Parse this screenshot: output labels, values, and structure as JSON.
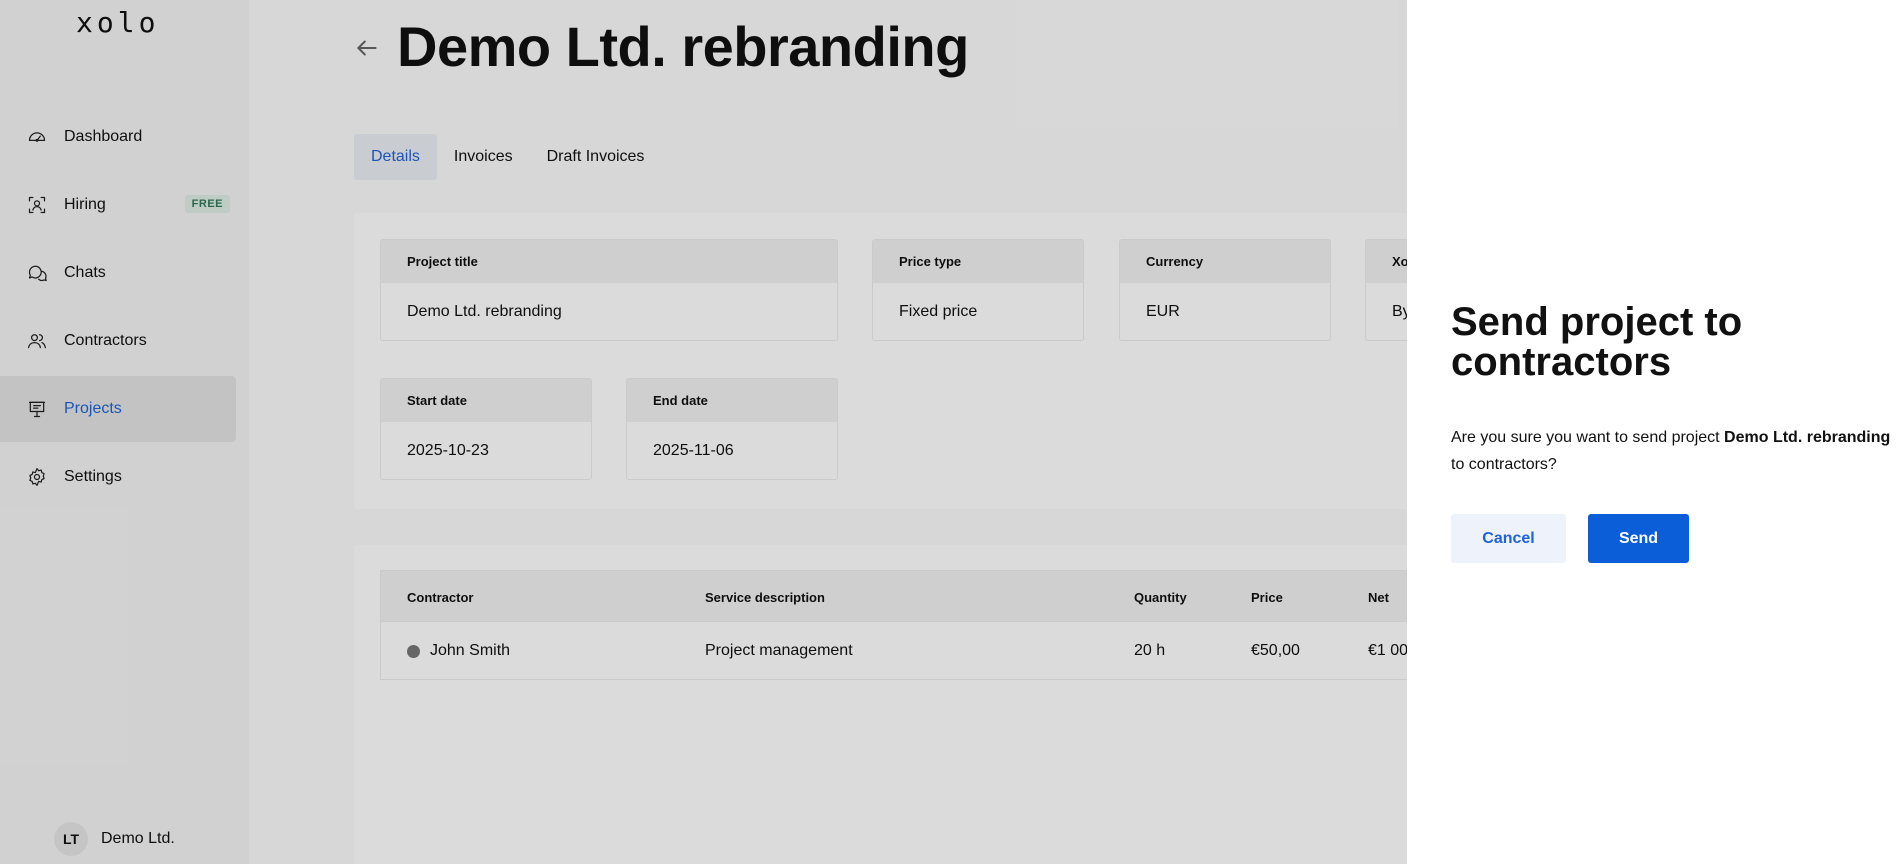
{
  "app": {
    "logo": "xolo"
  },
  "sidebar": {
    "items": [
      {
        "label": "Dashboard",
        "icon": "dashboard-icon"
      },
      {
        "label": "Hiring",
        "icon": "hiring-icon",
        "badge": "FREE"
      },
      {
        "label": "Chats",
        "icon": "chats-icon"
      },
      {
        "label": "Contractors",
        "icon": "contractors-icon"
      },
      {
        "label": "Projects",
        "icon": "projects-icon",
        "active": true
      },
      {
        "label": "Settings",
        "icon": "gear-icon"
      }
    ],
    "account": {
      "initials": "LT",
      "name": "Demo Ltd."
    }
  },
  "page": {
    "title": "Demo Ltd. rebranding",
    "tabs": [
      {
        "label": "Details",
        "active": true
      },
      {
        "label": "Invoices"
      },
      {
        "label": "Draft Invoices"
      }
    ]
  },
  "details": {
    "project_title": {
      "label": "Project title",
      "value": "Demo Ltd. rebranding"
    },
    "price_type": {
      "label": "Price type",
      "value": "Fixed price"
    },
    "currency": {
      "label": "Currency",
      "value": "EUR"
    },
    "xolo_field": {
      "label": "Xo",
      "value": "By"
    },
    "start_date": {
      "label": "Start date",
      "value": "2025-10-23"
    },
    "end_date": {
      "label": "End date",
      "value": "2025-11-06"
    }
  },
  "table": {
    "columns": [
      "Contractor",
      "Service description",
      "Quantity",
      "Price",
      "Net"
    ],
    "rows": [
      {
        "contractor": "John Smith",
        "service": "Project management",
        "quantity": "20 h",
        "price": "€50,00",
        "net": "€1 00"
      }
    ]
  },
  "dialog": {
    "title": "Send project to contractors",
    "text_before": "Are you sure you want to send project ",
    "project_name": "Demo Ltd. rebranding",
    "text_after": " to contractors?",
    "cancel_label": "Cancel",
    "send_label": "Send"
  },
  "colors": {
    "accent": "#1f63d6",
    "primary_button": "#0b5ed7",
    "badge_bg": "#dfeee6",
    "badge_text": "#2f7a55"
  }
}
